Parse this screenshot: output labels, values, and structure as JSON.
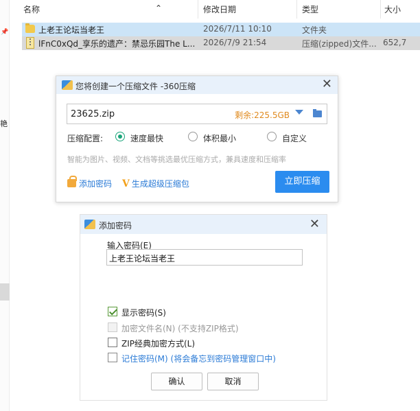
{
  "explorer": {
    "left_char": "艳",
    "columns": {
      "name": "名称",
      "modified": "修改日期",
      "type": "类型",
      "size": "大小"
    },
    "files": [
      {
        "name": "上老王论坛当老王",
        "modified": "2026/7/11 10:10",
        "type": "文件夹",
        "size": "",
        "icon": "folder-icon"
      },
      {
        "name": "lFnC0xQd_享乐的遗产：禁忌乐园The L...",
        "modified": "2026/7/9 21:54",
        "type": "压缩(zipped)文件...",
        "size": "652,7",
        "icon": "zip-icon"
      }
    ]
  },
  "compress_dialog": {
    "title": "您将创建一个压缩文件 -360压缩",
    "filename": "23625.zip",
    "remaining": "剩余:225.5GB",
    "config_label": "压缩配置:",
    "options": [
      "速度最快",
      "体积最小",
      "自定义"
    ],
    "selected_option": "速度最快",
    "hint": "智能为图片、视频、文档等挑选最优压缩方式，兼具速度和压缩率",
    "add_password": "添加密码",
    "super_zip": "生成超级压缩包",
    "super_zip_badge": "V",
    "compress_button": "立即压缩"
  },
  "password_dialog": {
    "title": "添加密码",
    "input_label": "输入密码(E)",
    "password_value": "上老王论坛当老王",
    "checkboxes": [
      {
        "label": "显示密码(S)",
        "checked": true,
        "enabled": true
      },
      {
        "label": "加密文件名(N) (不支持ZIP格式)",
        "checked": false,
        "enabled": false
      },
      {
        "label": "ZIP经典加密方式(L)",
        "checked": false,
        "enabled": true
      },
      {
        "label": "记住密码(M) (将会备忘到密码管理窗口中)",
        "checked": false,
        "enabled": true
      }
    ],
    "ok_button": "确认",
    "cancel_button": "取消"
  },
  "colors": {
    "accent": "#2b8cef",
    "warning": "#e08a1e",
    "selected_row": "#cce4f7",
    "radio_green": "#1aa57a"
  }
}
